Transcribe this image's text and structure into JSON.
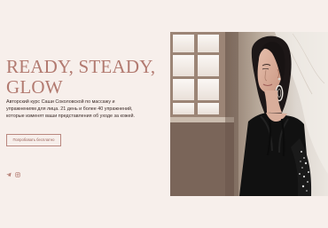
{
  "hero": {
    "headline_lines": [
      "READY, STEADY,",
      "GLOW"
    ],
    "description": "Авторский курс Саши Соколовской по массажу и упражнениям для лица. 21 день и более 40 упражнений, которые изменят ваши представления об уходе за кожей.",
    "cta_label": "Попробовать бесплатно"
  },
  "social": [
    {
      "icon": "telegram-icon"
    },
    {
      "icon": "instagram-icon"
    }
  ],
  "colors": {
    "background": "#f7efeb",
    "headline": "#b27a70",
    "button_border": "#b9877f"
  }
}
